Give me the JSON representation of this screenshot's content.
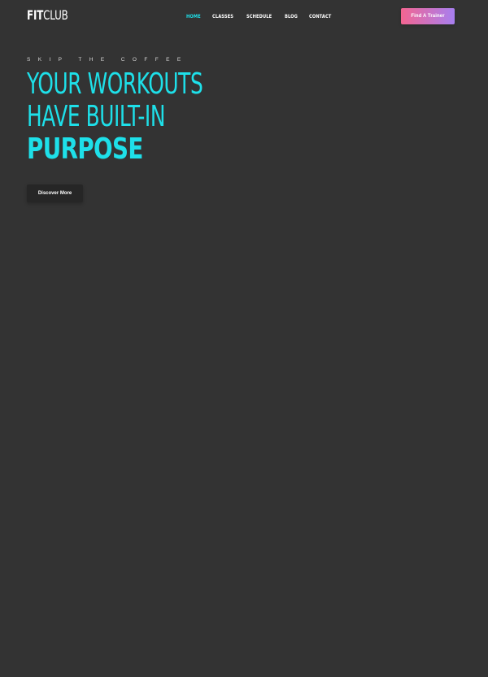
{
  "brand": {
    "logo_bold": "FIT",
    "logo_light": "CLUB"
  },
  "nav": {
    "items": [
      {
        "label": "HOME",
        "active": true
      },
      {
        "label": "CLASSES",
        "active": false
      },
      {
        "label": "SCHEDULE",
        "active": false
      },
      {
        "label": "BLOG",
        "active": false
      },
      {
        "label": "CONTACT",
        "active": false
      }
    ],
    "cta_label": "Find A Trainer"
  },
  "hero": {
    "eyebrow": "SKIP THE COFFEE",
    "line1": "YOUR WORKOUTS",
    "line2": "HAVE BUILT-IN",
    "line3": "PURPOSE",
    "button_label": "Discover More"
  },
  "colors": {
    "background": "#333333",
    "accent": "#1ee0e9",
    "button_dark": "#262626",
    "gradient_start": "#f46591",
    "gradient_end": "#a77ff0"
  }
}
